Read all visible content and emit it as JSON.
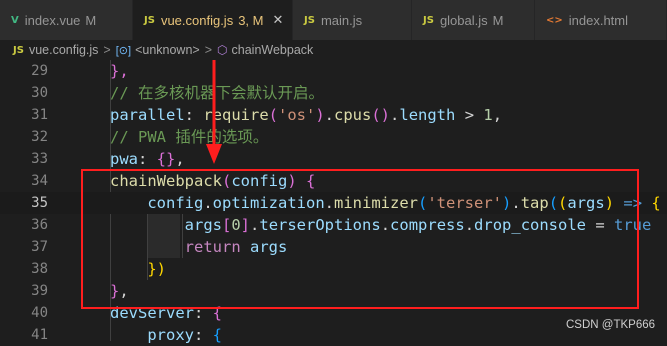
{
  "tabs": [
    {
      "icon": "V",
      "icon_color": "#41b883",
      "name": "index.vue",
      "status": "M",
      "active": false
    },
    {
      "icon": "JS",
      "icon_color": "#cbcb41",
      "name": "vue.config.js",
      "status": "3, M",
      "active": true,
      "close": "✕"
    },
    {
      "icon": "JS",
      "icon_color": "#cbcb41",
      "name": "main.js",
      "status": "",
      "active": false
    },
    {
      "icon": "JS",
      "icon_color": "#cbcb41",
      "name": "global.js",
      "status": "M",
      "active": false
    },
    {
      "icon": "<>",
      "icon_color": "#e37933",
      "name": "index.html",
      "status": "",
      "active": false
    }
  ],
  "breadcrumb": {
    "file_icon": "JS",
    "file": "vue.config.js",
    "separator": ">",
    "symbol_icon": "[⊙]",
    "symbol": "<unknown>",
    "method_icon": "⬡",
    "method": "chainWebpack"
  },
  "editor": {
    "lines": [
      {
        "n": "29",
        "tokens": [
          [
            "},",
            "b2"
          ]
        ]
      },
      {
        "n": "30",
        "tokens": [
          [
            "// 在多核机器下会默认开启。",
            "cm"
          ]
        ]
      },
      {
        "n": "31",
        "tokens": [
          [
            "parallel",
            "pr"
          ],
          [
            ": ",
            ""
          ],
          [
            "require",
            "fn"
          ],
          [
            "(",
            "b2"
          ],
          [
            "'os'",
            "st"
          ],
          [
            ")",
            "b2"
          ],
          [
            ".",
            ""
          ],
          [
            "cpus",
            "fn"
          ],
          [
            "()",
            "b2"
          ],
          [
            ".",
            ""
          ],
          [
            "length",
            "pr"
          ],
          [
            " > ",
            ""
          ],
          [
            "1",
            "nm"
          ],
          [
            ",",
            ""
          ]
        ]
      },
      {
        "n": "32",
        "tokens": [
          [
            "// PWA 插件的选项。",
            "cm"
          ]
        ]
      },
      {
        "n": "33",
        "tokens": [
          [
            "pwa",
            "pr"
          ],
          [
            ": ",
            ""
          ],
          [
            "{}",
            "b2"
          ],
          [
            ",",
            ""
          ]
        ]
      },
      {
        "n": "34",
        "tokens": [
          [
            "chainWebpack",
            "fn"
          ],
          [
            "(",
            "b2"
          ],
          [
            "config",
            "pr"
          ],
          [
            ")",
            "b2"
          ],
          [
            " ",
            ""
          ],
          [
            "{",
            "b2"
          ]
        ]
      },
      {
        "n": "35",
        "tokens": [
          [
            "    ",
            ""
          ],
          [
            "config",
            "pr"
          ],
          [
            ".",
            ""
          ],
          [
            "optimization",
            "pr"
          ],
          [
            ".",
            ""
          ],
          [
            "minimizer",
            "fn"
          ],
          [
            "(",
            "b3"
          ],
          [
            "'terser'",
            "st"
          ],
          [
            ")",
            "b3"
          ],
          [
            ".",
            ""
          ],
          [
            "tap",
            "fn"
          ],
          [
            "(",
            "b3"
          ],
          [
            "(",
            "b1"
          ],
          [
            "args",
            "pr"
          ],
          [
            ")",
            "b1"
          ],
          [
            " => ",
            "bl"
          ],
          [
            "{",
            "b1"
          ]
        ]
      },
      {
        "n": "36",
        "tokens": [
          [
            "        ",
            ""
          ],
          [
            "args",
            "pr"
          ],
          [
            "[",
            "b2"
          ],
          [
            "0",
            "nm"
          ],
          [
            "]",
            "b2"
          ],
          [
            ".",
            ""
          ],
          [
            "terserOptions",
            "pr"
          ],
          [
            ".",
            ""
          ],
          [
            "compress",
            "pr"
          ],
          [
            ".",
            ""
          ],
          [
            "drop_console",
            "pr"
          ],
          [
            " = ",
            ""
          ],
          [
            "true",
            "bl"
          ]
        ]
      },
      {
        "n": "37",
        "tokens": [
          [
            "        ",
            ""
          ],
          [
            "return",
            "kw"
          ],
          [
            " ",
            ""
          ],
          [
            "args",
            "pr"
          ]
        ]
      },
      {
        "n": "38",
        "tokens": [
          [
            "    ",
            ""
          ],
          [
            "})",
            "b1"
          ]
        ]
      },
      {
        "n": "39",
        "tokens": [
          [
            "}",
            "b2"
          ],
          [
            ",",
            ""
          ]
        ]
      },
      {
        "n": "40",
        "tokens": [
          [
            "devServer",
            "pr"
          ],
          [
            ": ",
            ""
          ],
          [
            "{",
            "b2"
          ]
        ]
      },
      {
        "n": "41",
        "tokens": [
          [
            "    ",
            ""
          ],
          [
            "proxy",
            "pr"
          ],
          [
            ": ",
            ""
          ],
          [
            "{",
            "b3"
          ]
        ]
      }
    ]
  },
  "annotation": {
    "box_color": "#ff1e1e",
    "arrow_color": "#ff1e1e"
  },
  "watermark": "CSDN @TKP666"
}
